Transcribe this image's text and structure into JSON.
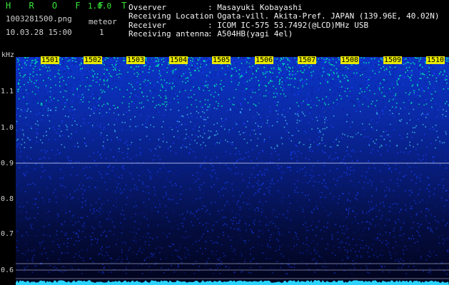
{
  "app": {
    "title": "H R O F F T",
    "version": "1.0.0"
  },
  "file": {
    "name": "1003281500.png",
    "timestamp": "10.03.28 15:00"
  },
  "meteor": {
    "label": "meteor",
    "count": "1"
  },
  "info": [
    {
      "key": "Ovserver",
      "value": ": Masayuki Kobayashi"
    },
    {
      "key": "Receiving Location",
      "value": ": Ogata-vill. Akita-Pref. JAPAN (139.96E, 40.02N)"
    },
    {
      "key": "Receiver",
      "value": ": ICOM IC-575 53.7492(@LCD)MHz USB"
    },
    {
      "key": "Receiving antenna",
      "value": ": A504HB(yagi 4el)"
    }
  ],
  "axis": {
    "y_unit": "kHz",
    "y_ticks": [
      "1.1",
      "1.0",
      "0.9",
      "0.8",
      "0.7",
      "0.6"
    ],
    "x_ticks": [
      "1501",
      "1502",
      "1503",
      "1504",
      "1505",
      "1506",
      "1507",
      "1508",
      "1509",
      "1510"
    ]
  },
  "colors": {
    "title_green": "#39e639",
    "tick_yellow": "#e9e900",
    "spectrum_high": "#00e0b0",
    "spectrum_mid": "#1a40ff",
    "spectrum_low": "#050a40",
    "reference_line": "#d8e0ff"
  }
}
